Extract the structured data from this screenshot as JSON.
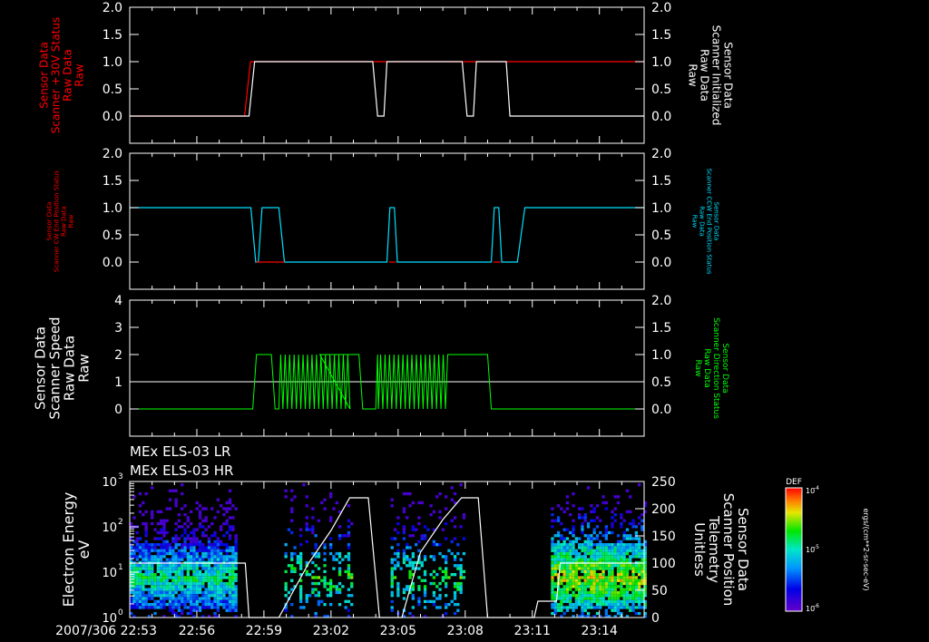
{
  "chart_data": [
    {
      "type": "line",
      "panel": 1,
      "left_label": [
        "Sensor Data",
        "Scanner +30V Status",
        "Raw Data",
        "Raw"
      ],
      "right_label": [
        "Sensor Data",
        "Scanner Initialized",
        "Raw Data",
        "Raw"
      ],
      "ylim": [
        -0.5,
        2.0
      ],
      "left_ticks": [
        "2.0",
        "1.5",
        "1.0",
        "0.5",
        "0.0"
      ],
      "right_ticks": [
        "2.0",
        "1.5",
        "1.0",
        "0.5",
        "0.0"
      ],
      "series": [
        {
          "color": "#ff0000",
          "x": [
            "22:53",
            "22:58:08",
            "22:58:24",
            "23:03",
            "23:03:12",
            "23:04:30",
            "23:04:42",
            "23:07:42",
            "23:07:54",
            "23:09:12",
            "23:09:24",
            "23:16"
          ],
          "y": [
            0,
            0,
            1,
            1,
            1,
            1,
            1,
            1,
            1,
            1,
            1,
            1
          ]
        },
        {
          "color": "#ffffff",
          "x": [
            "22:53",
            "22:58:20",
            "22:58:35",
            "23:03",
            "23:03:12",
            "23:03:52",
            "23:04:05",
            "23:06:01",
            "23:06:14",
            "23:06:50",
            "23:07:02",
            "23:09:12",
            "23:09:24",
            "23:16"
          ],
          "y": [
            0,
            0,
            1,
            1,
            1,
            1,
            1,
            1,
            1,
            1,
            1,
            1,
            1,
            1
          ]
        }
      ]
    },
    {
      "type": "line",
      "panel": 2,
      "left_label": [
        "Sensor Data",
        "Scanner CW End Position Status",
        "Raw Data",
        "Raw"
      ],
      "right_label": [
        "Sensor Data",
        "Scanner CCW End Position Status",
        "Raw Data",
        "Raw"
      ],
      "ylim": [
        -0.5,
        2.0
      ],
      "left_ticks": [
        "2.0",
        "1.5",
        "1.0",
        "0.5",
        "0.0"
      ],
      "right_ticks": [
        "2.0",
        "1.5",
        "1.0",
        "0.5",
        "0.0"
      ],
      "series": [
        {
          "color": "#ff0000",
          "x": [
            "22:53",
            "22:59",
            "23:16"
          ],
          "y": [
            1,
            0,
            0
          ]
        },
        {
          "color": "#00e0ff",
          "x": [
            "22:53",
            "22:58",
            "23:16"
          ],
          "y": [
            1,
            0,
            1
          ]
        }
      ]
    },
    {
      "type": "line",
      "panel": 3,
      "left_label": [
        "Sensor Data",
        "Scanner Speed",
        "Raw Data",
        "Raw"
      ],
      "right_label": [
        "Sensor Data",
        "Scanner Direction Status",
        "Raw Data",
        "Raw"
      ],
      "left_ylim": [
        -1,
        4
      ],
      "right_ylim": [
        -0.5,
        2.0
      ],
      "left_ticks": [
        "4",
        "3",
        "2",
        "1",
        "0"
      ],
      "right_ticks": [
        "2.0",
        "1.5",
        "1.0",
        "0.5",
        "0.0"
      ],
      "series": [
        {
          "color": "#ffffff",
          "axis": "left",
          "y_constant": 1
        },
        {
          "color": "#00ff00",
          "axis": "left",
          "x": [
            "22:53",
            "22:58:10",
            "22:58:20",
            "22:58:55",
            "22:59:05",
            "23:16"
          ],
          "y": [
            0,
            0,
            2,
            2,
            0,
            0
          ]
        }
      ]
    },
    {
      "type": "heatmap",
      "panel": 4,
      "titles": [
        "MEx ELS-03 LR",
        "MEx ELS-03 HR"
      ],
      "ylabel": [
        "Electron Energy",
        "eV"
      ],
      "ylog": true,
      "ylim": [
        1,
        1000
      ],
      "y_ticks": [
        "10",
        "10",
        "10",
        "10"
      ],
      "y_tick_exponents": [
        "3",
        "2",
        "1",
        "0"
      ],
      "right_label": [
        "Sensor Data",
        "Scanner Position",
        "Telemetry",
        "Unitless"
      ],
      "right_ylim": [
        0,
        250
      ],
      "right_ticks": [
        "250",
        "200",
        "150",
        "100",
        "50",
        "0"
      ],
      "x_ticks": [
        "2007/306 22:53",
        "22:56",
        "22:59",
        "23:02",
        "23:05",
        "23:08",
        "23:11",
        "23:14"
      ],
      "colorbar": {
        "title": "DEF",
        "top_label": "10",
        "top_exp": "-4",
        "mid_label": "10",
        "mid_exp": "-5",
        "bottom_label": "10",
        "bottom_exp": "-6",
        "units": "ergs/(cm**2-sr-sec-eV)"
      },
      "overlay_scanner_position": {
        "color": "#ffffff",
        "x": [
          "22:53",
          "22:58:10",
          "22:58:20",
          "22:59:40",
          "23:01",
          "23:02",
          "23:02:50",
          "23:03:40",
          "23:04:10",
          "23:05:10",
          "23:06",
          "23:07",
          "23:07:50",
          "23:08:35",
          "23:09:00",
          "23:11:05",
          "23:11:15",
          "23:12:05",
          "23:12:15",
          "23:16"
        ],
        "y": [
          100,
          100,
          0,
          0,
          100,
          160,
          220,
          220,
          0,
          0,
          120,
          180,
          220,
          220,
          0,
          0,
          30,
          30,
          100,
          100
        ]
      }
    }
  ],
  "colors": {
    "background": "#000000",
    "axes": "#ffffff",
    "panel1_left": "#ff0000",
    "panel2_right": "#00e0ff",
    "panel3_right": "#00ff00"
  }
}
